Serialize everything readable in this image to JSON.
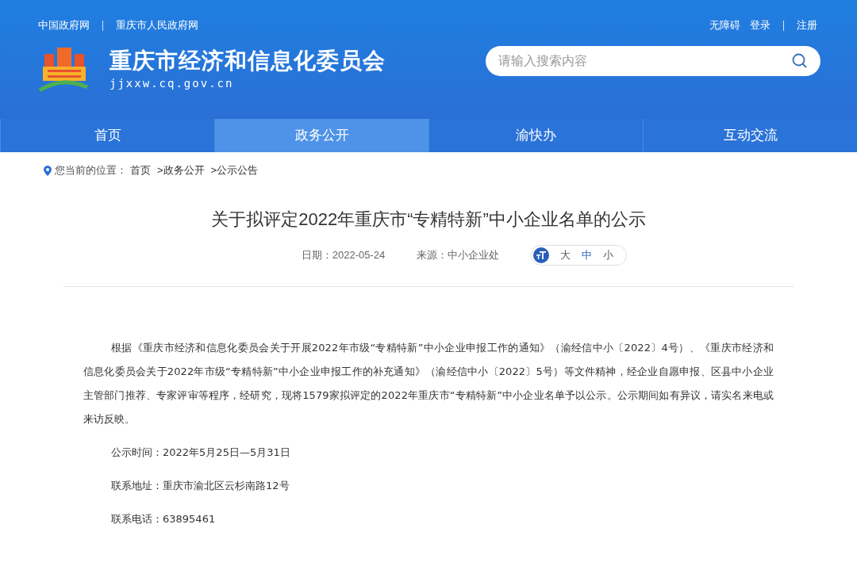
{
  "top_links": {
    "left": [
      "中国政府网",
      "重庆市人民政府网"
    ],
    "right": [
      "无障碍",
      "登录",
      "注册"
    ]
  },
  "site": {
    "name": "重庆市经济和信息化委员会",
    "domain": "jjxxw.cq.gov.cn"
  },
  "search": {
    "placeholder": "请输入搜索内容"
  },
  "nav": [
    {
      "label": "首页",
      "selected": false
    },
    {
      "label": "政务公开",
      "selected": true
    },
    {
      "label": "渝快办",
      "selected": false
    },
    {
      "label": "互动交流",
      "selected": false
    }
  ],
  "breadcrumb": {
    "label": "您当前的位置：",
    "items": [
      "首页",
      ">政务公开",
      ">公示公告"
    ]
  },
  "article": {
    "title": "关于拟评定2022年重庆市“专精特新”中小企业名单的公示",
    "date": "日期：2022-05-24",
    "source": "来源：中小企业处",
    "font_sizes": [
      {
        "label": "大",
        "selected": false
      },
      {
        "label": "中",
        "selected": true
      },
      {
        "label": "小",
        "selected": false
      }
    ],
    "body": "根据《重庆市经济和信息化委员会关于开展2022年市级“专精特新”中小企业申报工作的通知》（渝经信中小〔2022〕4号）、《重庆市经济和信息化委员会关于2022年市级“专精特新”中小企业申报工作的补充通知》（渝经信中小〔2022〕5号）等文件精神，经企业自愿申报、区县中小企业主管部门推荐、专家评审等程序，经研究，现将1579家拟评定的2022年重庆市“专精特新”中小企业名单予以公示。公示期间如有异议，请实名来电或来访反映。",
    "details": [
      "公示时间：2022年5月25日—5月31日",
      "联系地址：重庆市渝北区云杉南路12号",
      "联系电话：63895461"
    ]
  }
}
